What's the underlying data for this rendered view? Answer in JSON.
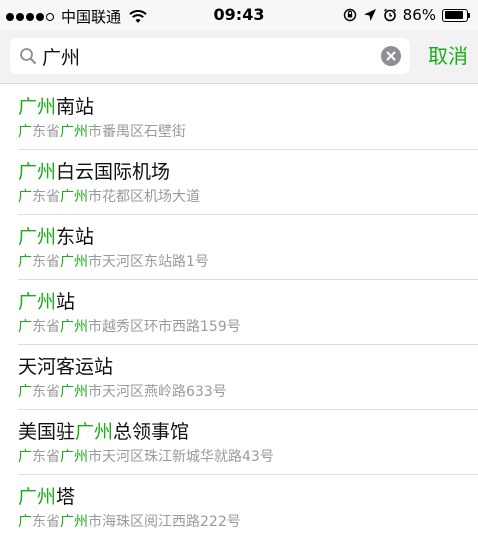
{
  "status_bar": {
    "carrier": "中国联通",
    "time": "09:43",
    "battery_percent": "86%",
    "battery_level": 0.86
  },
  "search": {
    "query": "广州",
    "cancel_label": "取消"
  },
  "colors": {
    "accent_green": "#1aad19",
    "address_gray": "#9a9a9a"
  },
  "results": [
    {
      "title": [
        {
          "t": "广州",
          "hl": true
        },
        {
          "t": "南站",
          "hl": false
        }
      ],
      "address": [
        {
          "t": "广",
          "hl": true
        },
        {
          "t": "东省",
          "hl": false
        },
        {
          "t": "广州",
          "hl": true
        },
        {
          "t": "市番禺区石壁街",
          "hl": false
        }
      ]
    },
    {
      "title": [
        {
          "t": "广州",
          "hl": true
        },
        {
          "t": "白云国际机场",
          "hl": false
        }
      ],
      "address": [
        {
          "t": "广",
          "hl": true
        },
        {
          "t": "东省",
          "hl": false
        },
        {
          "t": "广州",
          "hl": true
        },
        {
          "t": "市花都区机场大道",
          "hl": false
        }
      ]
    },
    {
      "title": [
        {
          "t": "广州",
          "hl": true
        },
        {
          "t": "东站",
          "hl": false
        }
      ],
      "address": [
        {
          "t": "广",
          "hl": true
        },
        {
          "t": "东省",
          "hl": false
        },
        {
          "t": "广州",
          "hl": true
        },
        {
          "t": "市天河区东站路1号",
          "hl": false
        }
      ]
    },
    {
      "title": [
        {
          "t": "广州",
          "hl": true
        },
        {
          "t": "站",
          "hl": false
        }
      ],
      "address": [
        {
          "t": "广",
          "hl": true
        },
        {
          "t": "东省",
          "hl": false
        },
        {
          "t": "广州",
          "hl": true
        },
        {
          "t": "市越秀区环市西路159号",
          "hl": false
        }
      ]
    },
    {
      "title": [
        {
          "t": "天河客运站",
          "hl": false
        }
      ],
      "address": [
        {
          "t": "广",
          "hl": true
        },
        {
          "t": "东省",
          "hl": false
        },
        {
          "t": "广州",
          "hl": true
        },
        {
          "t": "市天河区燕岭路633号",
          "hl": false
        }
      ]
    },
    {
      "title": [
        {
          "t": "美国驻",
          "hl": false
        },
        {
          "t": "广州",
          "hl": true
        },
        {
          "t": "总领事馆",
          "hl": false
        }
      ],
      "address": [
        {
          "t": "广",
          "hl": true
        },
        {
          "t": "东省",
          "hl": false
        },
        {
          "t": "广州",
          "hl": true
        },
        {
          "t": "市天河区珠江新城华就路43号",
          "hl": false
        }
      ]
    },
    {
      "title": [
        {
          "t": "广州",
          "hl": true
        },
        {
          "t": "塔",
          "hl": false
        }
      ],
      "address": [
        {
          "t": "广",
          "hl": true
        },
        {
          "t": "东省",
          "hl": false
        },
        {
          "t": "广州",
          "hl": true
        },
        {
          "t": "市海珠区阅江西路222号",
          "hl": false
        }
      ]
    }
  ]
}
